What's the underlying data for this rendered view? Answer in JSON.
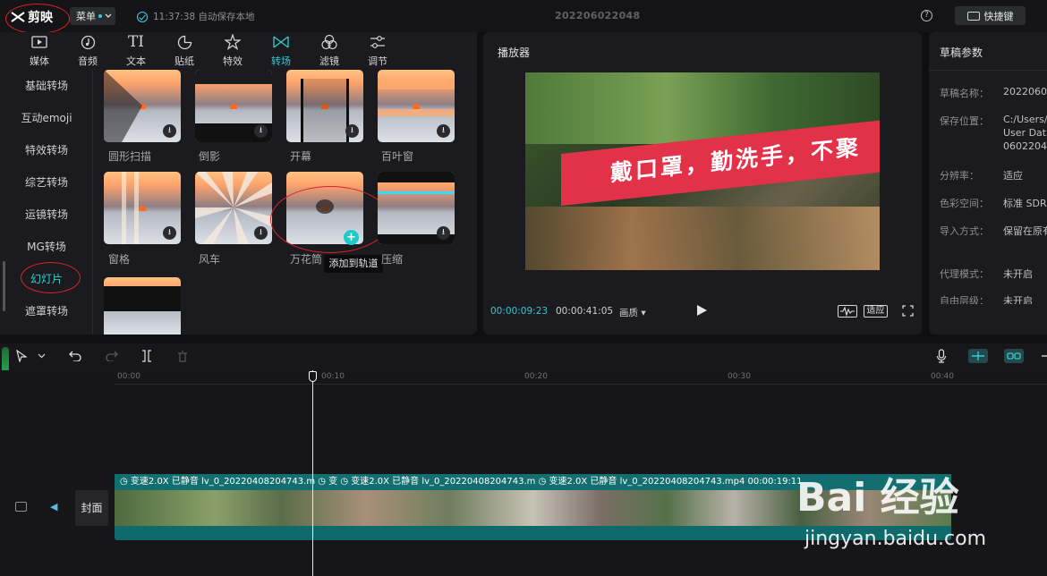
{
  "topbar": {
    "app_name": "剪映",
    "menu_label": "菜单",
    "autosave_text": "11:37:38 自动保存本地",
    "project_title": "202206022048",
    "help_label": "?",
    "shortcut_label": "快捷键"
  },
  "library": {
    "tabs": [
      {
        "label": "媒体",
        "icon": "media-icon",
        "active": false
      },
      {
        "label": "音频",
        "icon": "audio-icon",
        "active": false
      },
      {
        "label": "文本",
        "icon": "text-icon",
        "active": false
      },
      {
        "label": "贴纸",
        "icon": "sticker-icon",
        "active": false
      },
      {
        "label": "特效",
        "icon": "effects-icon",
        "active": false
      },
      {
        "label": "转场",
        "icon": "transition-icon",
        "active": true
      },
      {
        "label": "滤镜",
        "icon": "filter-icon",
        "active": false
      },
      {
        "label": "调节",
        "icon": "adjust-icon",
        "active": false
      }
    ],
    "categories": [
      "基础转场",
      "互动emoji",
      "特效转场",
      "综艺转场",
      "运镜转场",
      "MG转场",
      "幻灯片",
      "遮罩转场"
    ],
    "active_category": "幻灯片",
    "items": [
      "圆形扫描",
      "倒影",
      "开幕",
      "百叶窗",
      "窗格",
      "风车",
      "万花筒",
      "压缩"
    ],
    "tooltip": "添加到轨道",
    "add_symbol": "+"
  },
  "player": {
    "title": "播放器",
    "banner_text": "戴口罩，勤洗手，不聚",
    "current_time": "00:00:09:23",
    "total_time": "00:00:41:05",
    "quality_label": "画质",
    "fit_label": "适应"
  },
  "params": {
    "title": "草稿参数",
    "rows": [
      {
        "label": "草稿名称：",
        "value": "20220602"
      },
      {
        "label": "保存位置：",
        "value": "C:/Users/"
      },
      {
        "label": "",
        "value": "User Data"
      },
      {
        "label": "",
        "value": "06022048"
      },
      {
        "label": "分辨率：",
        "value": "适应"
      },
      {
        "label": "色彩空间：",
        "value": "标准 SDR"
      },
      {
        "label": "导入方式：",
        "value": "保留在原有"
      },
      {
        "label": "代理模式：",
        "value": "未开启"
      },
      {
        "label": "自由层级：",
        "value": "未开启"
      }
    ]
  },
  "timeline": {
    "ticks": [
      "00:00",
      "00:10",
      "00:20",
      "00:30",
      "00:40"
    ],
    "clip_header": "◷ 变速2.0X   已静音   lv_0_20220408204743.m ◷ 变 ◷ 变速2.0X   已静音   lv_0_20220408204743.m ◷ 变速2.0X   已静音   lv_0_20220408204743.mp4   00:00:19:11",
    "cover_label": "封面"
  },
  "watermark": {
    "main": "Bai 经验",
    "sub": "jingyan.baidu.com"
  }
}
